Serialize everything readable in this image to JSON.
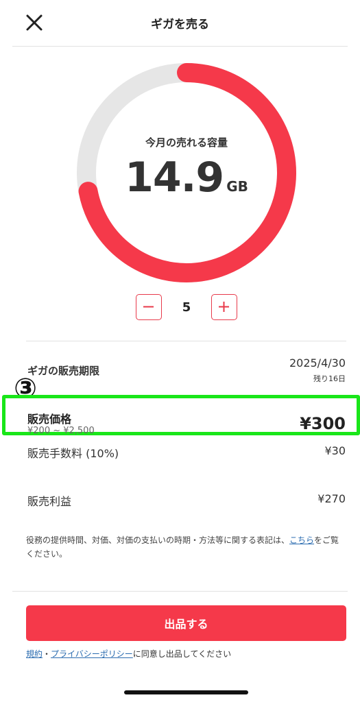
{
  "header": {
    "title": "ギガを売る",
    "close_icon": "close-icon"
  },
  "gauge": {
    "label": "今月の売れる容量",
    "value": "14.9",
    "unit": "GB",
    "remaining_fraction": 0.72,
    "color": "#f5394a",
    "track_color": "#e6e6e6"
  },
  "stepper": {
    "value": "5",
    "minus_icon": "minus-icon",
    "plus_icon": "plus-icon"
  },
  "sale_period": {
    "label": "ギガの販売期限",
    "date": "2025/4/30",
    "remaining": "残り16日"
  },
  "annotation": {
    "marker": "③",
    "highlight_color": "#19e619"
  },
  "price": {
    "label": "販売価格",
    "range": "¥200 ~ ¥2,500",
    "value": "¥300"
  },
  "fee": {
    "label": "販売手数料 (10%)",
    "value": "¥30"
  },
  "profit": {
    "label": "販売利益",
    "value": "¥270"
  },
  "notice": {
    "before": "役務の提供時間、対価、対価の支払いの時期・方法等に関する表記は、",
    "link": "こちら",
    "after": "をご覧ください。"
  },
  "action": {
    "sell_button": "出品する"
  },
  "consent": {
    "terms_link": "規約",
    "separator": "・",
    "privacy_link": "プライバシーポリシー",
    "suffix": "に同意し出品してください"
  },
  "colors": {
    "accent": "#f5394a",
    "link": "#2b6cb0"
  }
}
